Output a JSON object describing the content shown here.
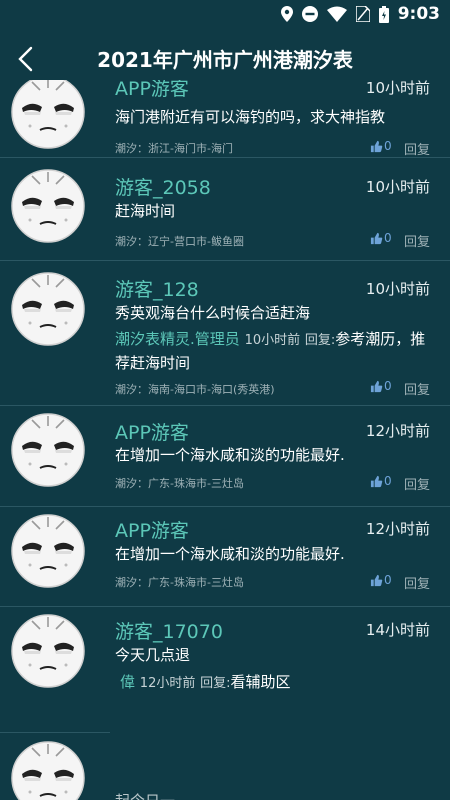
{
  "status": {
    "time": "9:03"
  },
  "header": {
    "title": "2021年广州市广州港潮汐表"
  },
  "comments": [
    {
      "user": "APP游客",
      "time": "10小时前",
      "message": "海门港附近有可以海钓的吗，求大神指教",
      "location": "潮汐：浙江-海门市-海门",
      "likes": "0",
      "reply_label": "回复"
    },
    {
      "user": "游客_2058",
      "time": "10小时前",
      "message": "赶海时间",
      "location": "潮汐：辽宁-营口市-鲅鱼圈",
      "likes": "0",
      "reply_label": "回复"
    },
    {
      "user": "游客_128",
      "time": "10小时前",
      "message": "秀英观海台什么时候合适赶海",
      "reply": {
        "name": "潮汐表精灵.管理员",
        "time": "10小时前",
        "label": "回复:",
        "text": "参考潮历，推荐赶海时间"
      },
      "location": "潮汐：海南-海口市-海口(秀英港)",
      "likes": "0",
      "reply_label": "回复"
    },
    {
      "user": "APP游客",
      "time": "12小时前",
      "message": "在增加一个海水咸和淡的功能最好.",
      "location": "潮汐：广东-珠海市-三灶岛",
      "likes": "0",
      "reply_label": "回复"
    },
    {
      "user": "APP游客",
      "time": "12小时前",
      "message": "在增加一个海水咸和淡的功能最好.",
      "location": "潮汐：广东-珠海市-三灶岛",
      "likes": "0",
      "reply_label": "回复"
    },
    {
      "user": "游客_17070",
      "time": "14小时前",
      "message": "今天几点退",
      "reply": {
        "name": "偉",
        "time": "12小时前",
        "label": "回复:",
        "text": "看辅助区"
      }
    },
    {
      "bottom_text": "起今日一"
    }
  ],
  "colors": {
    "background": "#0f3a45",
    "username": "#5cc7b8",
    "like_count": "#6ea3d8",
    "muted": "#9fb2b7"
  }
}
